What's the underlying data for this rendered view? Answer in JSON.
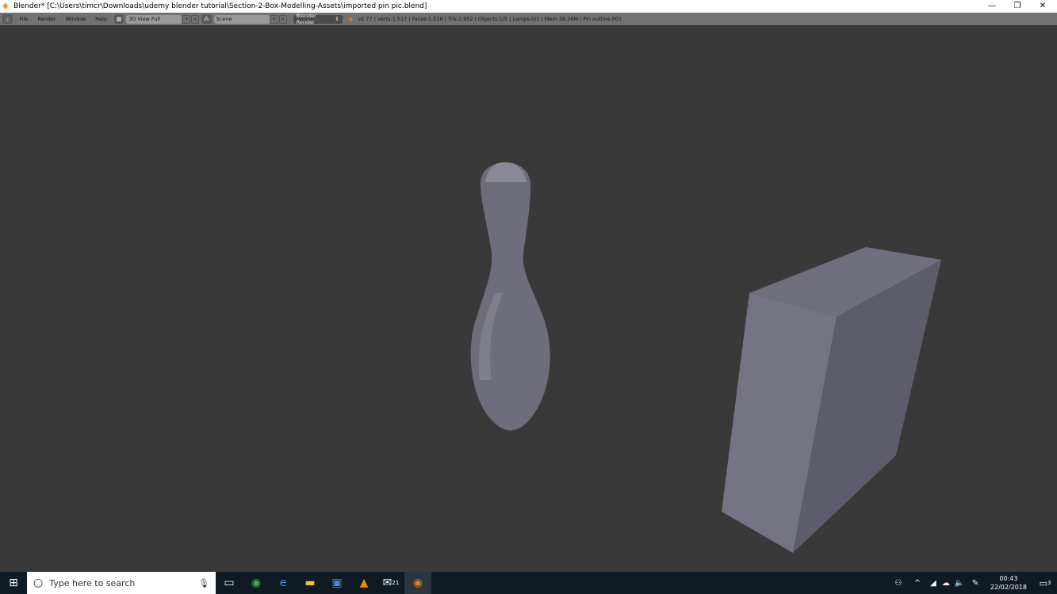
{
  "window": {
    "title": "Blender* [C:\\Users\\timcr\\Downloads\\udemy blender tutorial\\Section-2-Box-Modelling-Assets\\imported pin pic.blend]"
  },
  "header": {
    "menus": [
      "File",
      "Render",
      "Window",
      "Help"
    ],
    "screen_layout": "3D View Full",
    "scene": "Scene",
    "render_engine": "Blender Render",
    "stats": "v2.77 | Verts:1,517 | Faces:1,518 | Tris:2,952 | Objects:1/5 | Lamps:0/1 | Mem:28.26M | Pin outline.001"
  },
  "taskbar": {
    "search_placeholder": "Type here to search",
    "time": "00:43",
    "date": "22/02/2018",
    "mail_badge": "21",
    "notifications": "3"
  },
  "colors": {
    "viewport": "#393939",
    "mesh": "#6c6c7c",
    "taskbar": "#101a22"
  }
}
